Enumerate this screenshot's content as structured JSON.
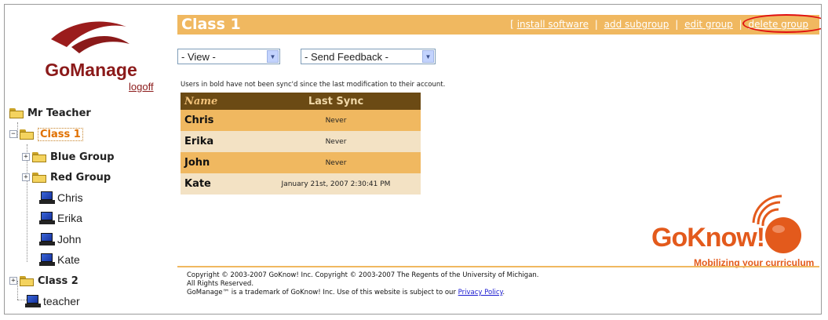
{
  "app": {
    "logo_text": "GoManage",
    "logoff": "logoff"
  },
  "tree": {
    "root": "Mr Teacher",
    "class1": "Class 1",
    "groups": [
      "Blue Group",
      "Red Group"
    ],
    "students": [
      "Chris",
      "Erika",
      "John",
      "Kate"
    ],
    "class2": "Class 2",
    "teacher": "teacher"
  },
  "header": {
    "title": "Class 1",
    "bracket": "[",
    "actions": [
      "install software",
      "add subgroup",
      "edit group",
      "delete group"
    ],
    "separator": "|"
  },
  "controls": {
    "view_select": "- View -",
    "feedback_select": "- Send Feedback -"
  },
  "hint": "Users in bold have not been sync'd since the last modification to their account.",
  "table": {
    "columns": [
      "Name",
      "Last Sync"
    ],
    "rows": [
      {
        "name": "Chris",
        "sync": "Never"
      },
      {
        "name": "Erika",
        "sync": "Never"
      },
      {
        "name": "John",
        "sync": "Never"
      },
      {
        "name": "Kate",
        "sync": "January 21st, 2007 2:30:41 PM"
      }
    ]
  },
  "brand": {
    "name": "GoKnow!",
    "tagline": "Mobilizing your curriculum"
  },
  "footer": {
    "line1": "Copyright © 2003-2007 GoKnow! Inc. Copyright © 2003-2007 The Regents of the University of Michigan.",
    "line2": "All Rights Reserved.",
    "line3": "GoManage™ is a trademark of GoKnow! Inc. Use of this website is subject to our",
    "privacy_link": "Privacy Policy",
    "period": "."
  },
  "colors": {
    "accent": "#f0b860",
    "brand_red": "#8b1a1a",
    "goknow_orange": "#e35a1c",
    "table_header": "#6b4a14"
  },
  "icons": [
    "gomanage-logo-icon",
    "folder-icon",
    "computer-icon",
    "expand-plus-icon",
    "goknow-logo-icon",
    "dropdown-arrow-icon"
  ]
}
